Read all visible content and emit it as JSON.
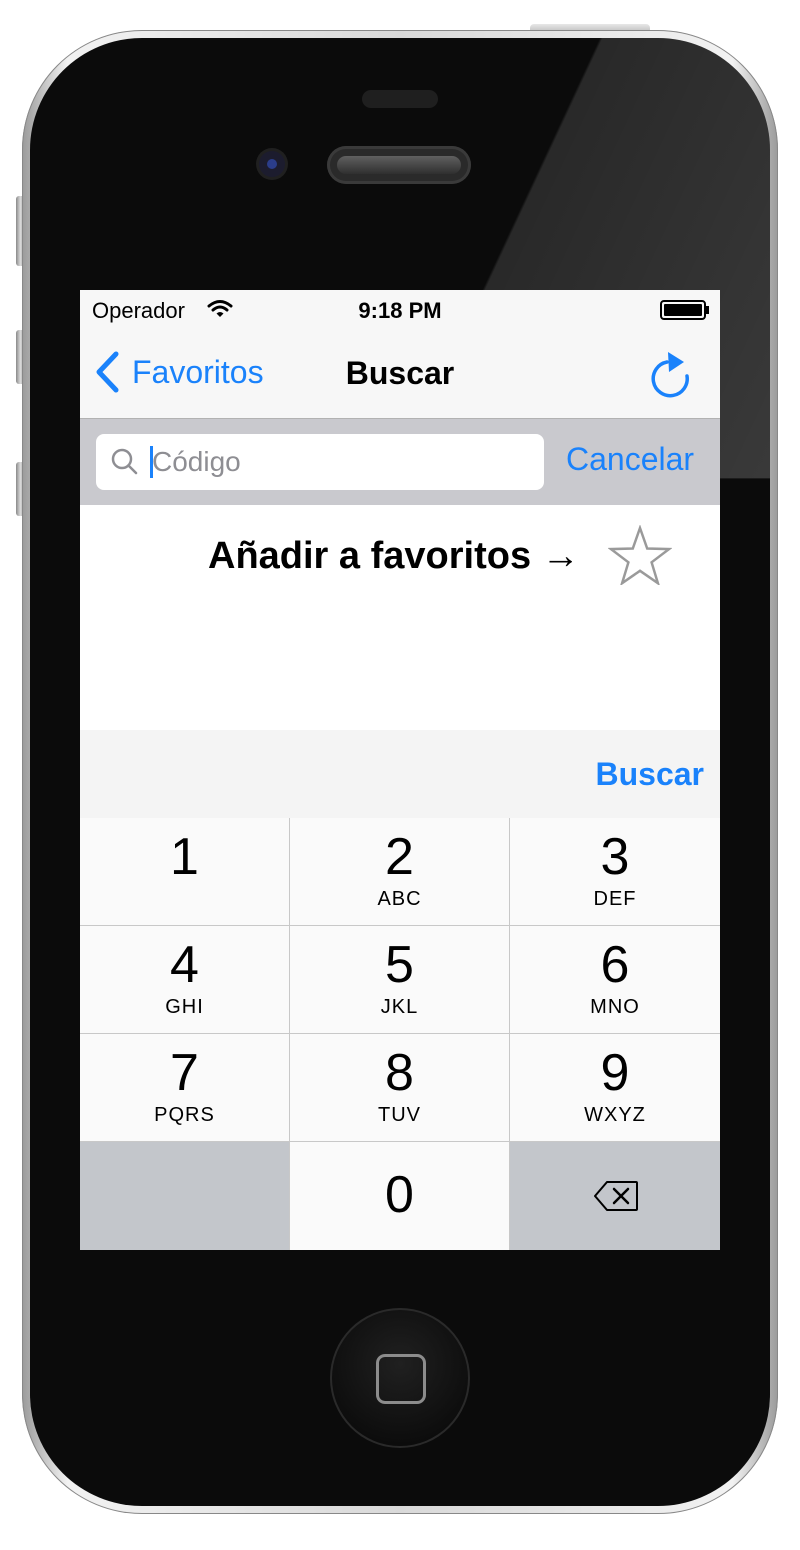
{
  "status_bar": {
    "carrier": "Operador",
    "time": "9:18 PM"
  },
  "nav": {
    "back_label": "Favoritos",
    "title": "Buscar",
    "refresh_icon": "refresh-icon"
  },
  "search": {
    "placeholder": "Código",
    "cancel_label": "Cancelar"
  },
  "content": {
    "hint": "Añadir a favoritos →",
    "star_icon": "star-outline-icon"
  },
  "accessory": {
    "search_label": "Buscar"
  },
  "keypad": {
    "keys": [
      {
        "digit": "1",
        "letters": ""
      },
      {
        "digit": "2",
        "letters": "ABC"
      },
      {
        "digit": "3",
        "letters": "DEF"
      },
      {
        "digit": "4",
        "letters": "GHI"
      },
      {
        "digit": "5",
        "letters": "JKL"
      },
      {
        "digit": "6",
        "letters": "MNO"
      },
      {
        "digit": "7",
        "letters": "PQRS"
      },
      {
        "digit": "8",
        "letters": "TUV"
      },
      {
        "digit": "9",
        "letters": "WXYZ"
      }
    ],
    "zero": "0",
    "delete_icon": "backspace-icon"
  },
  "colors": {
    "accent": "#1a82fb",
    "keypad_dark": "#c3c6cb",
    "search_bar_bg": "#c9c9ce"
  }
}
